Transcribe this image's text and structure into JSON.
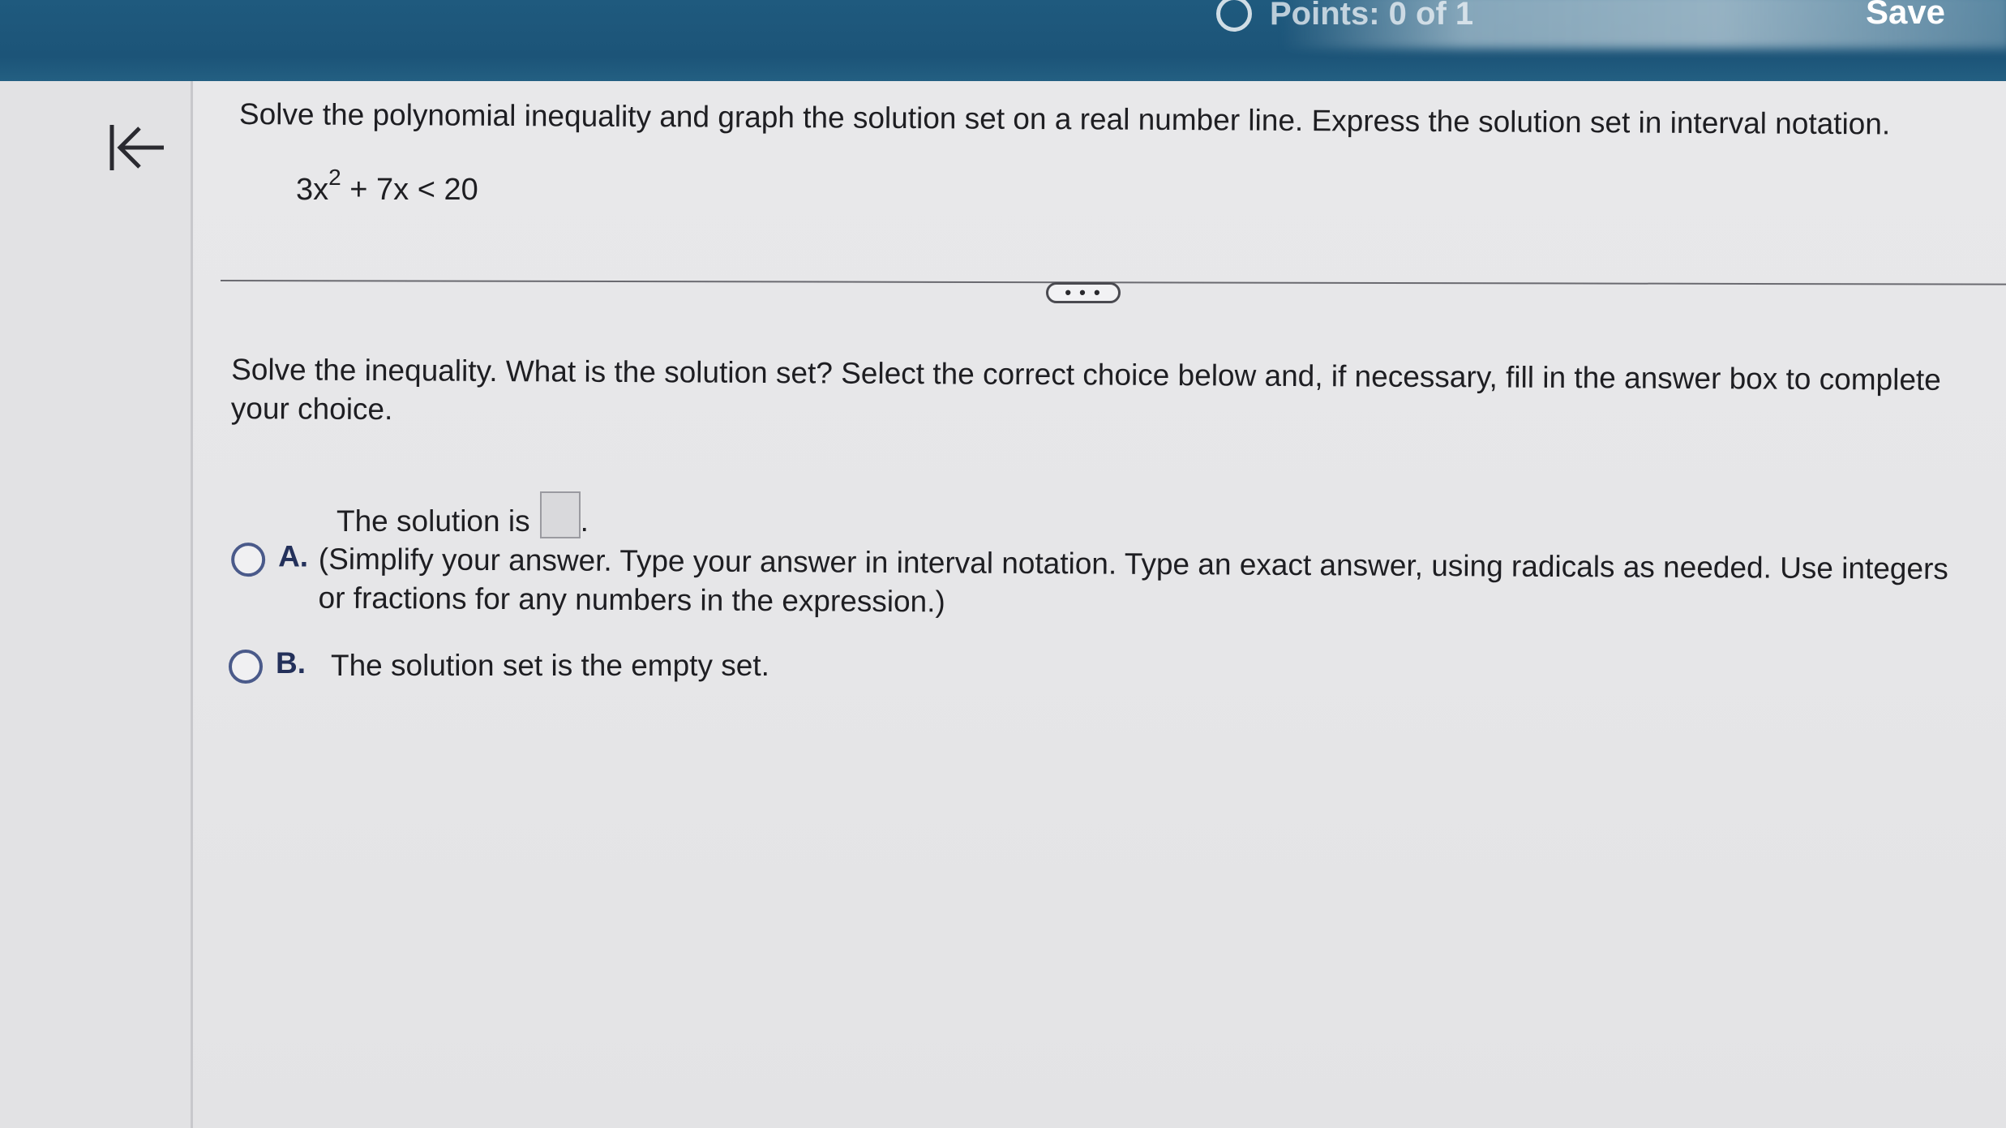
{
  "header": {
    "points_label": "Points: 0 of 1",
    "save_label": "Save"
  },
  "problem": {
    "instruction": "Solve the polynomial inequality and graph the solution set on a real number line. Express the solution set in interval notation.",
    "equation": {
      "part1": "3x",
      "exponent": "2",
      "part2": " + 7x < 20"
    }
  },
  "more_button_label": "• • •",
  "question": {
    "prompt": "Solve the inequality. What is the solution set? Select the correct choice below and, if necessary, fill in the answer box to complete your choice."
  },
  "choices": {
    "a": {
      "letter": "A.",
      "solution_prefix": "The solution is",
      "solution_suffix": ".",
      "answer_value": "",
      "hint": "(Simplify your answer. Type your answer in interval notation. Type an exact answer, using radicals as needed. Use integers or fractions for any numbers in the expression.)"
    },
    "b": {
      "letter": "B.",
      "text": "The solution set is the empty set."
    }
  },
  "colors": {
    "header_bg": "#1f5a7e",
    "radio_border": "#4a5a8a",
    "choice_letter": "#23305a"
  },
  "icons": {
    "collapse": "arrow-left-to-bar-icon",
    "points": "circle-ring-icon"
  }
}
